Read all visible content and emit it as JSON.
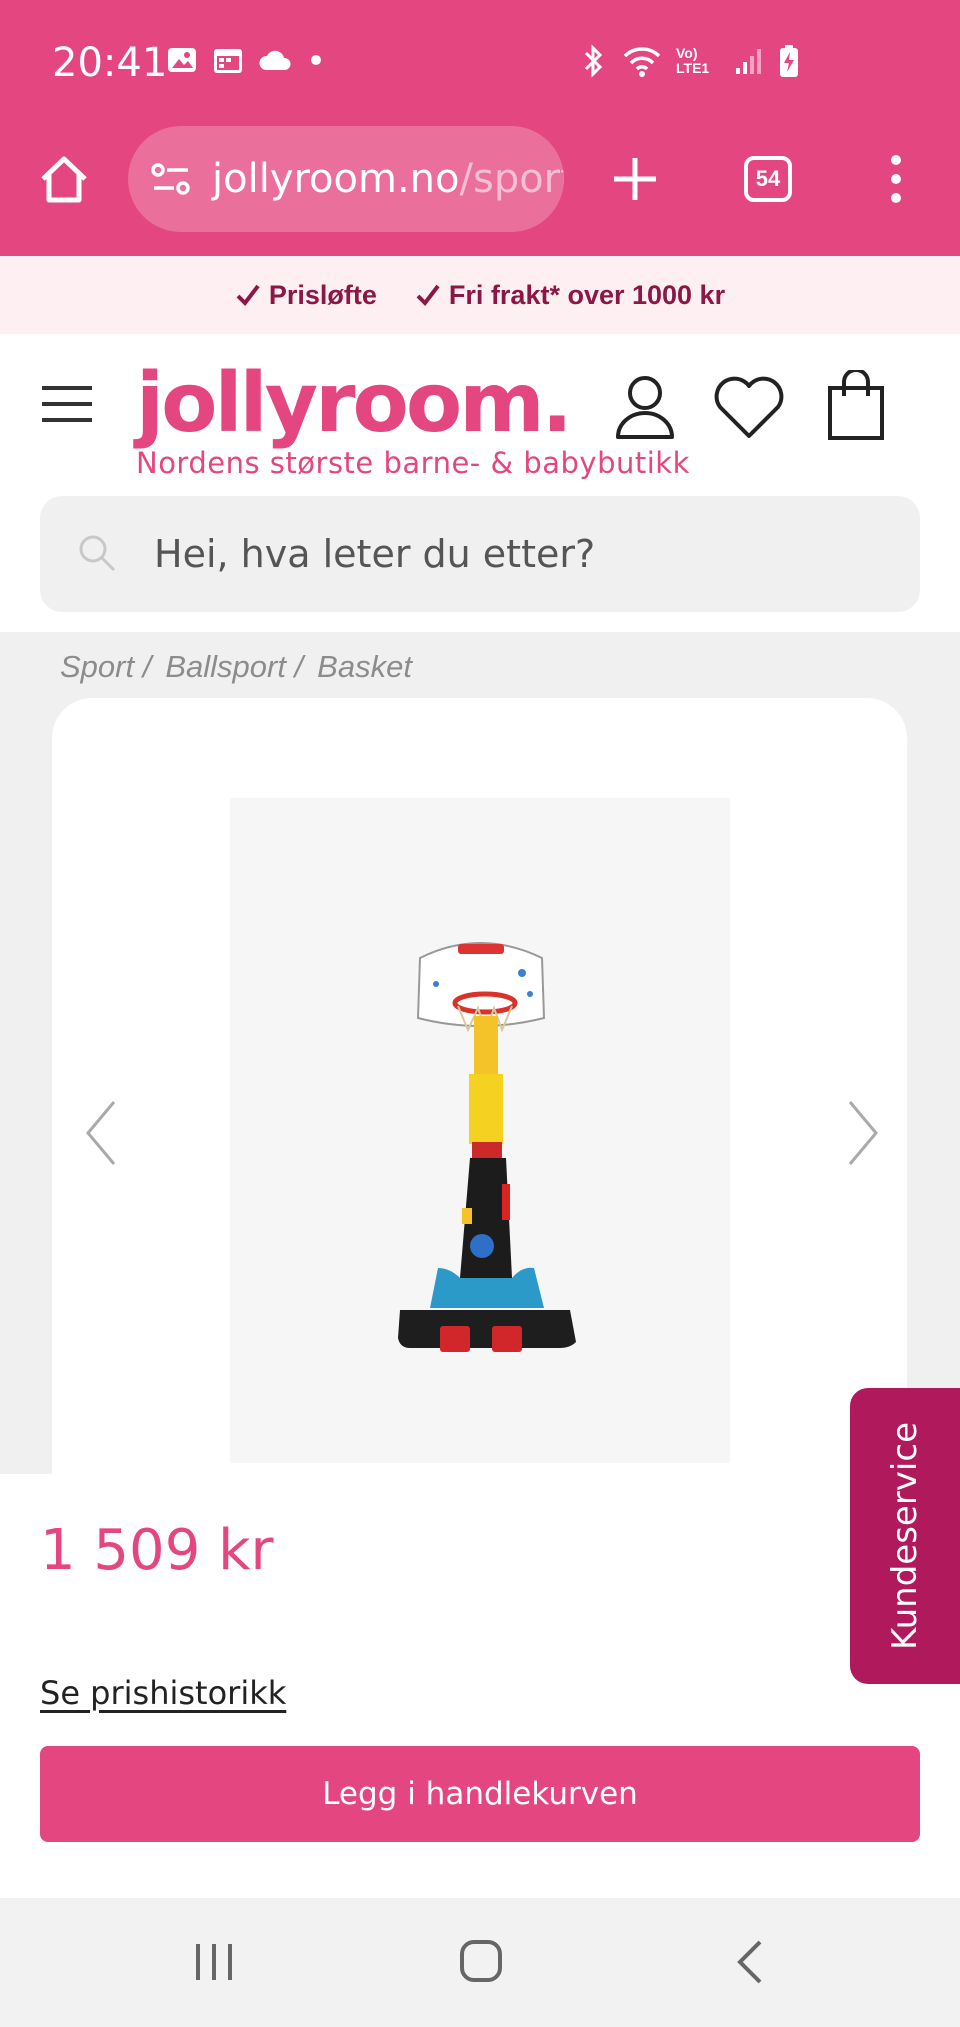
{
  "status_bar": {
    "time": "20:41",
    "network_label": "Vo) LTE1"
  },
  "browser": {
    "url_domain": "jollyroom.no",
    "url_path": "/sport",
    "tab_count": "54"
  },
  "promo": {
    "items": [
      "Prisløfte",
      "Fri frakt* over 1000 kr"
    ]
  },
  "header": {
    "logo": "jollyroom.",
    "tagline": "Nordens største barne- & babybutikk",
    "search_placeholder": "Hei, hva leter du etter?"
  },
  "breadcrumb": [
    "Sport /",
    "Ballsport /",
    "Basket"
  ],
  "product": {
    "price": "1 509 kr",
    "price_history_link": "Se prishistorikk",
    "add_to_cart_label": "Legg i handlekurven"
  },
  "customer_service_label": "Kundeservice",
  "colors": {
    "brand_pink": "#e4477f",
    "service_tab": "#b0195c",
    "promo_text": "#8b1744"
  }
}
